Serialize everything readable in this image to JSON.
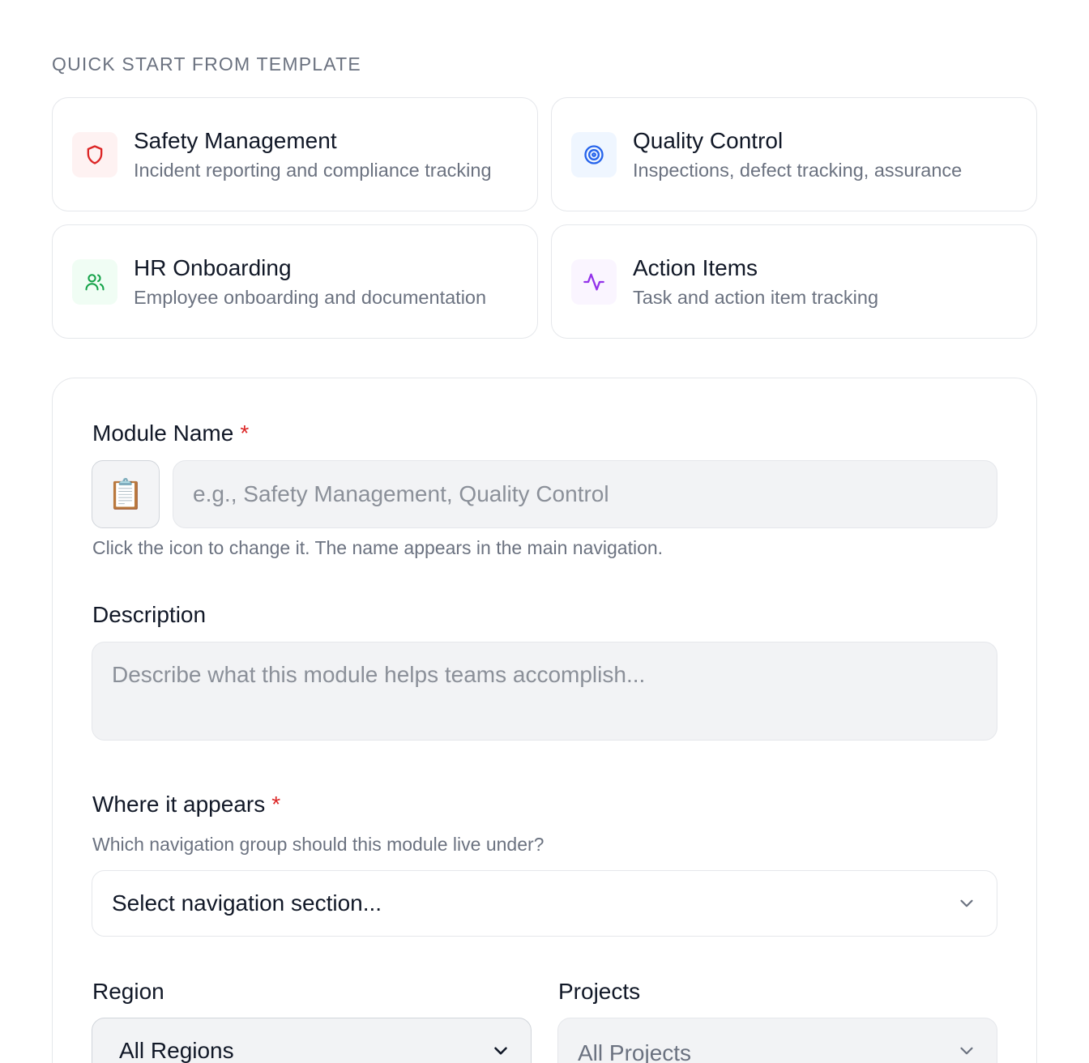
{
  "templates": {
    "heading": "QUICK START FROM TEMPLATE",
    "items": [
      {
        "name": "Safety Management",
        "description": "Incident reporting and compliance tracking",
        "icon": "shield-icon",
        "color": "#dc2626",
        "bg": "#fef2f2"
      },
      {
        "name": "Quality Control",
        "description": "Inspections, defect tracking, assurance",
        "icon": "target-icon",
        "color": "#2563eb",
        "bg": "#eff6ff"
      },
      {
        "name": "HR Onboarding",
        "description": "Employee onboarding and documentation",
        "icon": "users-icon",
        "color": "#16a34a",
        "bg": "#f0fdf4"
      },
      {
        "name": "Action Items",
        "description": "Task and action item tracking",
        "icon": "activity-icon",
        "color": "#9333ea",
        "bg": "#faf5ff"
      }
    ]
  },
  "form": {
    "module_name": {
      "label": "Module Name",
      "required_mark": "*",
      "icon": "📋",
      "placeholder": "e.g., Safety Management, Quality Control",
      "value": "",
      "hint": "Click the icon to change it. The name appears in the main navigation."
    },
    "description": {
      "label": "Description",
      "placeholder": "Describe what this module helps teams accomplish...",
      "value": ""
    },
    "where": {
      "label": "Where it appears",
      "required_mark": "*",
      "hint": "Which navigation group should this module live under?",
      "selected": "Select navigation section..."
    },
    "region": {
      "label": "Region",
      "selected": "All Regions"
    },
    "projects": {
      "label": "Projects",
      "selected": "All Projects"
    }
  },
  "colors": {
    "required": "#dc2626",
    "muted_text": "#6b7280",
    "border": "#e5e7eb",
    "input_bg": "#f2f3f5"
  }
}
